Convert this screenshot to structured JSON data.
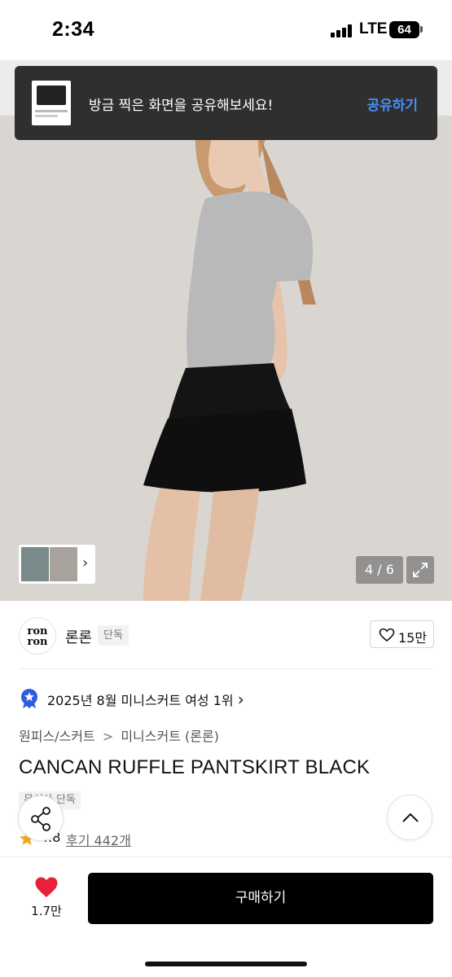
{
  "status_bar": {
    "time": "2:34",
    "network": "LTE",
    "battery": "64"
  },
  "toast": {
    "message": "방금 찍은 화면을 공유해보세요!",
    "action": "공유하기"
  },
  "gallery": {
    "page_indicator": "4 / 6",
    "thumbnail_arrow": "›"
  },
  "brand": {
    "name": "론론",
    "tag": "단독",
    "logo_text_line1": "ron",
    "logo_text_line2": "ron",
    "likes": "15만"
  },
  "ranking": {
    "text": "2025년 8월 미니스커트 여성 1위",
    "chevron": "›"
  },
  "breadcrumb": {
    "category": "원피스/스커트",
    "separator": ">",
    "subcategory": "미니스커트 (론론)"
  },
  "product": {
    "title": "CANCAN RUFFLE PANTSKIRT BLACK",
    "tag": "무신사 단독"
  },
  "rating": {
    "score": "4.8",
    "reviews": "후기 442개"
  },
  "bottom_bar": {
    "wish_count": "1.7만",
    "buy_label": "구매하기"
  },
  "colors": {
    "accent_blue": "#4a8cf7",
    "heart_red": "#e8203a",
    "rank_badge": "#2f5be0",
    "star": "#f5a623"
  },
  "icons": [
    "share-icon",
    "chevron-up-icon",
    "heart-icon",
    "expand-icon",
    "star-icon",
    "rank-badge-icon"
  ]
}
